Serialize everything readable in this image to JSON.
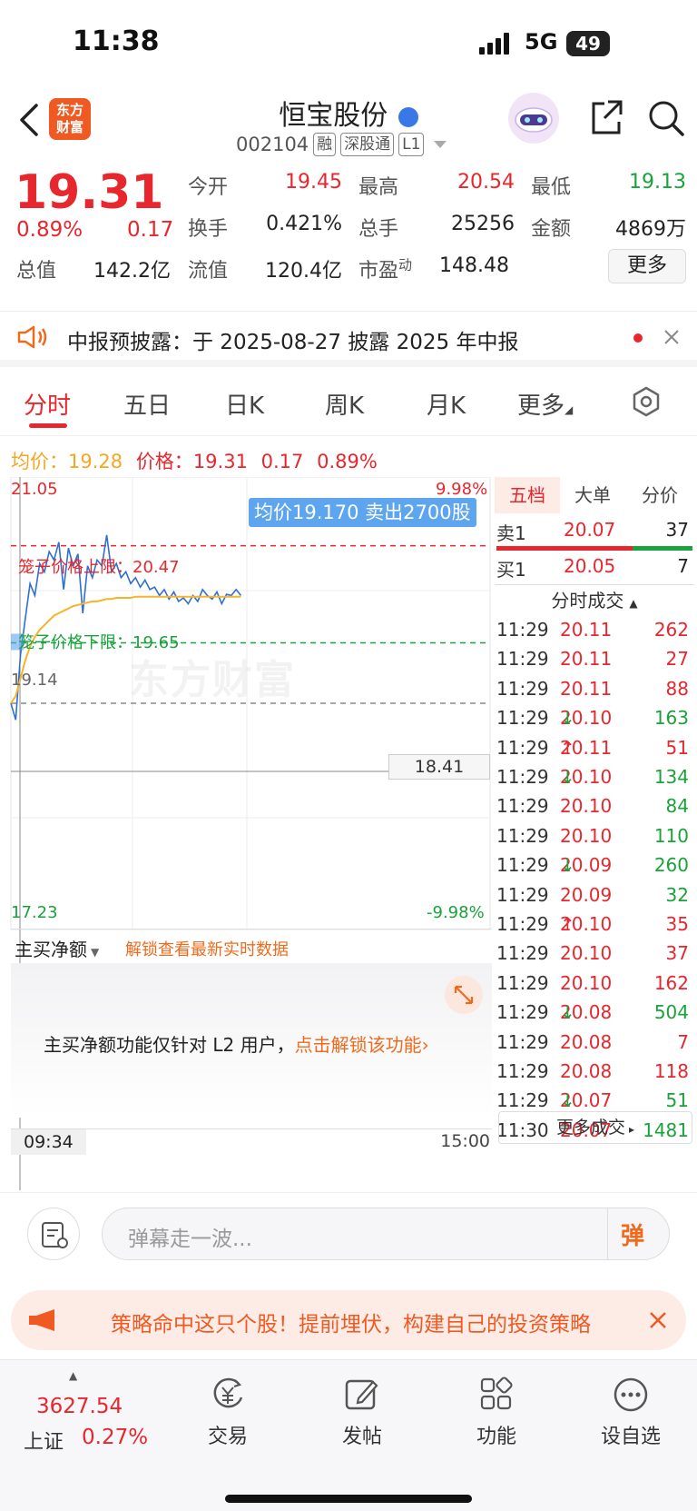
{
  "status_bar": {
    "time": "11:38",
    "network": "5G",
    "battery": "49"
  },
  "header": {
    "title": "恒宝股份",
    "code": "002104",
    "tags": [
      "融",
      "深股通",
      "L1"
    ],
    "logo_line1": "东方",
    "logo_line2": "财富"
  },
  "quote": {
    "price": "19.31",
    "change_pct": "0.89%",
    "change": "0.17",
    "fields": {
      "open_label": "今开",
      "open": "19.45",
      "high_label": "最高",
      "high": "20.54",
      "low_label": "最低",
      "low": "19.13",
      "turnover_label": "换手",
      "turnover": "0.421%",
      "volume_label": "总手",
      "volume": "25256",
      "amount_label": "金额",
      "amount": "4869万",
      "mktcap_label": "总值",
      "mktcap": "142.2亿",
      "float_label": "流值",
      "float": "120.4亿",
      "pe_label": "市盈",
      "pe_sup": "动",
      "pe": "148.48"
    },
    "more_button": "更多"
  },
  "notice": {
    "text": "中报预披露：于 2025-08-27 披露 2025 年中报"
  },
  "tabs": [
    "分时",
    "五日",
    "日K",
    "周K",
    "月K",
    "更多"
  ],
  "chart_legend": {
    "avg_label": "均价：",
    "avg": "19.28",
    "price_label": "价格：",
    "price": "19.31",
    "change": "0.17",
    "pct": "0.89%"
  },
  "chart_labels": {
    "y_top": "21.05",
    "y_top_pct": "9.98%",
    "y_bottom": "17.23",
    "y_bottom_pct": "-9.98%",
    "prev_close": "19.14",
    "cursor_price": "18.41",
    "upper_limit": "笼子价格上限：20.47",
    "lower_limit": "笼子价格下限：19.65",
    "tooltip": "均价19.170 卖出2700股",
    "time_start": "09:34",
    "time_end": "15:00",
    "watermark": "东方财富"
  },
  "chart_data": {
    "type": "line",
    "ylim": [
      17.23,
      21.05
    ],
    "y_tick_labels": [
      "21.05",
      "17.23"
    ],
    "prev_close": 19.14,
    "series": [
      {
        "values": [
          19.14,
          19.0,
          19.55,
          19.85,
          20.15,
          20.05,
          20.32,
          20.25,
          20.42,
          20.35,
          20.5,
          20.1,
          20.45,
          20.3,
          20.4,
          19.9,
          20.3,
          20.2,
          20.35,
          20.3,
          20.56,
          20.25,
          20.32,
          20.2,
          20.25,
          20.15,
          20.2,
          20.12,
          20.18,
          20.1,
          20.12,
          20.05,
          20.1,
          20.02,
          20.08,
          20.0,
          20.03,
          19.98,
          20.05,
          20.0,
          20.1,
          20.05,
          20.02,
          20.08,
          19.98,
          20.06,
          20.05,
          20.1,
          20.05
        ]
      },
      {
        "values": [
          19.14,
          19.2,
          19.35,
          19.5,
          19.62,
          19.7,
          19.76,
          19.8,
          19.84,
          19.88,
          19.9,
          19.92,
          19.94,
          19.96,
          19.97,
          19.98,
          19.99,
          20.0,
          20.0,
          20.01,
          20.02,
          20.02,
          20.03,
          20.03,
          20.03,
          20.03,
          20.04,
          20.04,
          20.04,
          20.04,
          20.04,
          20.04,
          20.04,
          20.04,
          20.04,
          20.04,
          20.04,
          20.04,
          20.04,
          20.04,
          20.04,
          20.04,
          20.04,
          20.04,
          20.04,
          20.04,
          20.04,
          20.04,
          20.04
        ]
      }
    ],
    "reference_lines": [
      20.47,
      19.65,
      19.14
    ]
  },
  "net_buy": {
    "label": "主买净额",
    "unlock_link": "解锁查看最新实时数据",
    "body_text": "主买净额功能仅针对 L2 用户，",
    "body_link": "点击解锁该功能"
  },
  "book": {
    "tabs": [
      "五档",
      "大单",
      "分价"
    ],
    "sell": {
      "label": "卖1",
      "price": "20.07",
      "vol": "37"
    },
    "buy": {
      "label": "买1",
      "price": "20.05",
      "vol": "7"
    },
    "trades_header": "分时成交",
    "trades": [
      {
        "time": "11:29",
        "price": "20.11",
        "arrow": "",
        "vol": "262",
        "side": "red"
      },
      {
        "time": "11:29",
        "price": "20.11",
        "arrow": "",
        "vol": "27",
        "side": "red"
      },
      {
        "time": "11:29",
        "price": "20.11",
        "arrow": "",
        "vol": "88",
        "side": "red"
      },
      {
        "time": "11:29",
        "price": "20.10",
        "arrow": "↓",
        "vol": "163",
        "side": "green"
      },
      {
        "time": "11:29",
        "price": "20.11",
        "arrow": "↑",
        "vol": "51",
        "side": "red"
      },
      {
        "time": "11:29",
        "price": "20.10",
        "arrow": "↓",
        "vol": "134",
        "side": "green"
      },
      {
        "time": "11:29",
        "price": "20.10",
        "arrow": "",
        "vol": "84",
        "side": "green"
      },
      {
        "time": "11:29",
        "price": "20.10",
        "arrow": "",
        "vol": "110",
        "side": "green"
      },
      {
        "time": "11:29",
        "price": "20.09",
        "arrow": "↓",
        "vol": "260",
        "side": "green"
      },
      {
        "time": "11:29",
        "price": "20.09",
        "arrow": "",
        "vol": "32",
        "side": "green"
      },
      {
        "time": "11:29",
        "price": "20.10",
        "arrow": "↑",
        "vol": "35",
        "side": "red"
      },
      {
        "time": "11:29",
        "price": "20.10",
        "arrow": "",
        "vol": "37",
        "side": "red"
      },
      {
        "time": "11:29",
        "price": "20.10",
        "arrow": "",
        "vol": "162",
        "side": "red"
      },
      {
        "time": "11:29",
        "price": "20.08",
        "arrow": "↓",
        "vol": "504",
        "side": "green"
      },
      {
        "time": "11:29",
        "price": "20.08",
        "arrow": "",
        "vol": "7",
        "side": "red"
      },
      {
        "time": "11:29",
        "price": "20.08",
        "arrow": "",
        "vol": "118",
        "side": "red"
      },
      {
        "time": "11:29",
        "price": "20.07",
        "arrow": "↓",
        "vol": "51",
        "side": "green"
      },
      {
        "time": "11:30",
        "price": "20.07",
        "arrow": "",
        "vol": "1481",
        "side": "green"
      }
    ],
    "more_trades": "更多成交"
  },
  "danmaku": {
    "placeholder": "弹幕走一波...",
    "send_label": "弹"
  },
  "promo": {
    "text": "策略命中这只个股！提前埋伏，构建自己的投资策略"
  },
  "bottom": {
    "index_value": "3627.54",
    "index_name": "上证",
    "index_pct": "0.27%",
    "items": [
      {
        "label": "交易",
        "icon": "yen-cycle-icon"
      },
      {
        "label": "发帖",
        "icon": "edit-icon"
      },
      {
        "label": "功能",
        "icon": "grid-icon"
      },
      {
        "label": "设自选",
        "icon": "more-dots-icon"
      }
    ]
  },
  "colors": {
    "up": "#e8262d",
    "down": "#19a33a",
    "accent": "#f06a1d",
    "avg_line": "#f5b52a",
    "price_line": "#2f6fd1"
  }
}
